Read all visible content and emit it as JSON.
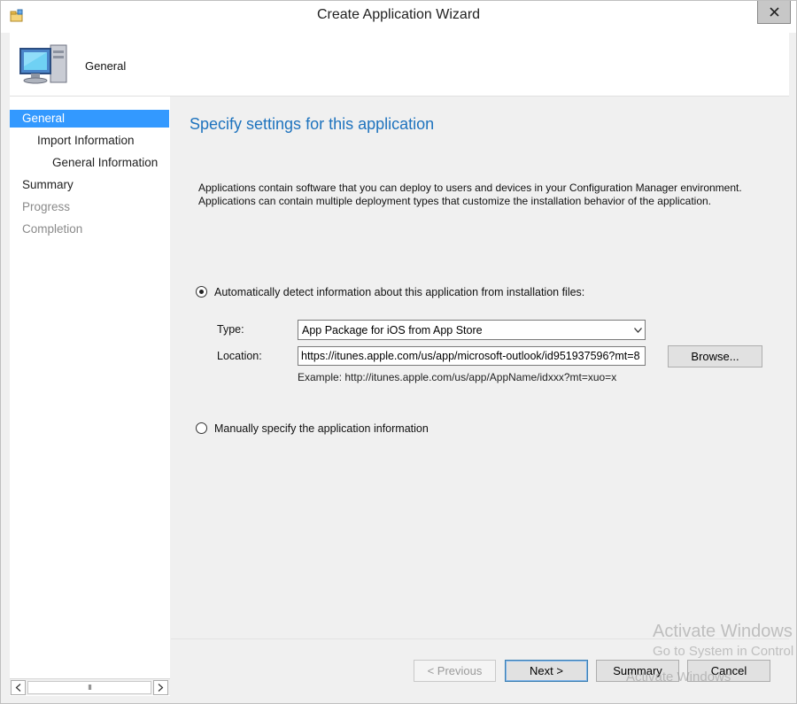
{
  "window": {
    "title": "Create Application Wizard",
    "close_label": "close"
  },
  "header": {
    "title": "General",
    "icon": "computer-icon"
  },
  "nav": {
    "items": [
      {
        "label": "General",
        "state": "selected",
        "level": 0
      },
      {
        "label": "Import Information",
        "state": "normal",
        "level": 1
      },
      {
        "label": "General Information",
        "state": "normal",
        "level": 2
      },
      {
        "label": "Summary",
        "state": "normal",
        "level": 0
      },
      {
        "label": "Progress",
        "state": "disabled",
        "level": 0
      },
      {
        "label": "Completion",
        "state": "disabled",
        "level": 0
      }
    ],
    "scroll_thumb": "III"
  },
  "content": {
    "title": "Specify settings for this application",
    "description_line1": "Applications contain software that you can deploy to users and devices in your Configuration Manager environment.",
    "description_line2": "Applications can contain multiple deployment types that customize the installation behavior of the application.",
    "auto_detect_label": "Automatically detect information about this application from installation files:",
    "auto_detect_checked": true,
    "type_label": "Type:",
    "type_value": "App Package for iOS from App Store",
    "location_label": "Location:",
    "location_value": "https://itunes.apple.com/us/app/microsoft-outlook/id951937596?mt=8",
    "browse_label": "Browse...",
    "example_text": "Example: http://itunes.apple.com/us/app/AppName/idxxx?mt=xuo=x",
    "manual_label": "Manually specify the application information",
    "manual_checked": false
  },
  "buttons": {
    "previous": "< Previous",
    "next": "Next >",
    "summary": "Summary",
    "cancel": "Cancel"
  },
  "watermark": {
    "line1": "Activate Windows",
    "line2": "Go to System in Control Panel",
    "line3": "Activate Windows"
  },
  "colors": {
    "accent": "#3399ff",
    "title_blue": "#1e73be"
  }
}
